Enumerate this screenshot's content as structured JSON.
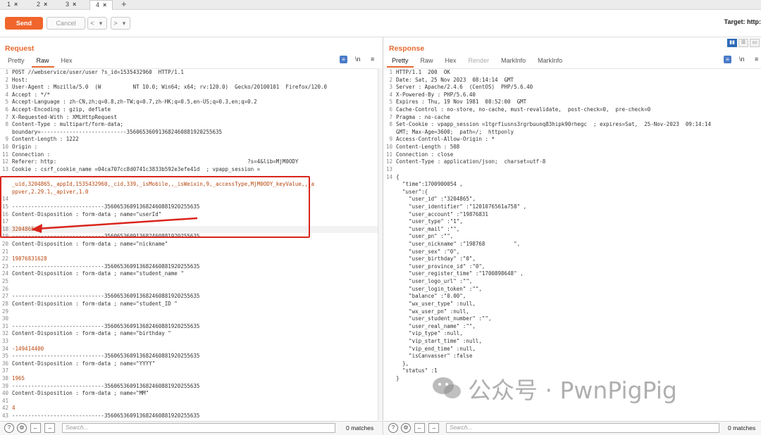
{
  "tabs": [
    {
      "label": "1",
      "close": "×"
    },
    {
      "label": "2",
      "close": "×"
    },
    {
      "label": "3",
      "close": "×"
    },
    {
      "label": "4",
      "close": "×",
      "active": true
    }
  ],
  "tab_add": "+",
  "toolbar": {
    "send_label": "Send",
    "cancel_label": "Cancel",
    "back": "<",
    "back_menu": "▾",
    "forward": ">",
    "forward_menu": "▾",
    "target_label": "Target: http:"
  },
  "request": {
    "title": "Request",
    "tabs": [
      "Pretty",
      "Raw",
      "Hex"
    ],
    "active_tab": "Raw",
    "wrap_label": "\\n",
    "menu_label": "≡",
    "lines": [
      "POST //webservice/user/user ?s_id=1535432960  HTTP/1.1",
      "Host:",
      "User-Agent : Mozilla/5.0  (W          NT 10.0; Win64; x64; rv:120.0)  Gecko/20100101  Firefox/120.0",
      "Accept : */*",
      "Accept-Language : zh-CN,zh;q=0.8,zh-TW;q=0.7,zh-HK;q=0.5,en-US;q=0.3,en;q=0.2",
      "Accept-Encoding : gzip, deflate",
      "X-Requested-With : XMLHttpRequest",
      "Content-Type : multipart/form-data;",
      "boundary=---------------------------356065360913682460881920255635",
      "Content-Length : 1222",
      "Origin :",
      "Connection :",
      "Referer: http:                                                            ?s=4&lib=MjM0ODY",
      "Cookie : csrf_cookie_name =04ca707cc8d0741c3833b592e3efe41d  ; vpapp_session =",
      "",
      "_uid,3204865,_appId,1535432960,_cid,339,_isMobile,,_isWeixin,9,_accessType,MjM0ODY_keyValue,,_a",
      "ppver,2.29.1,_apiver,1.0",
      "",
      "-----------------------------356065360913682460881920255635",
      "Content-Disposition : form-data ; name=\"userId\"",
      "",
      "3204865",
      "-----------------------------356065360913682460881920255635",
      "Content-Disposition : form-data ; name=\"nickname\"",
      "",
      "19876831628",
      "-----------------------------356065360913682460881920255635",
      "Content-Disposition : form-data ; name=\"student_name \"",
      "",
      "",
      "-----------------------------356065360913682460881920255635",
      "Content-Disposition : form-data ; name=\"student_ID \"",
      "",
      "",
      "-----------------------------356065360913682460881920255635",
      "Content-Disposition : form-data ; name=\"birthday \"",
      "",
      "-149414400",
      "-----------------------------356065360913682460881920255635",
      "Content-Disposition : form-data ; name=\"YYYY\"",
      "",
      "1965",
      "-----------------------------356065360913682460881920255635",
      "Content-Disposition : form-data ; name=\"MM\"",
      "",
      "4",
      "-----------------------------356065360913682460881920255635"
    ],
    "line_numbers": [
      "1",
      "2",
      "3",
      "4",
      "5",
      "6",
      "7",
      "8",
      "",
      "9",
      "10",
      "11",
      "12",
      "13",
      "",
      "",
      "",
      "14",
      "15",
      "16",
      "17",
      "18",
      "19",
      "20",
      "21",
      "22",
      "23",
      "24",
      "25",
      "26",
      "27",
      "28",
      "29",
      "30",
      "31",
      "32",
      "33",
      "34",
      "35",
      "36",
      "37",
      "38",
      "39",
      "40",
      "41",
      "42",
      "43"
    ],
    "search_placeholder": "Search...",
    "matches": "0 matches"
  },
  "response": {
    "title": "Response",
    "tabs": [
      "Pretty",
      "Raw",
      "Hex",
      "Render",
      "MarkInfo",
      "MarkInfo"
    ],
    "active_tab": "Pretty",
    "wrap_label": "\\n",
    "menu_label": "≡",
    "lines": [
      "HTTP/1.1  200  OK",
      "Date: Sat, 25 Nov 2023  08:14:14  GMT",
      "Server : Apache/2.4.6  (CentOS)  PHP/5.6.40",
      "X-Powered-By : PHP/5.6.40",
      "Expires : Thu, 19 Nov 1981  08:52:00  GMT",
      "Cache-Control : no-store, no-cache, must-revalidate,  post-check=0,  pre-check=0",
      "Pragma : no-cache",
      "Set-Cookie : vpapp_session =1tgrfiusns3rgrbuunq83hipk90rhegc  ; expires=Sat,  25-Nov-2023  09:14:14",
      "GMT; Max-Age=3600;  path=/;  httponly",
      "Access-Control-Allow-Origin : *",
      "Content-Length : 508",
      "Connection : close",
      "Content-Type : application/json;  charset=utf-8",
      "",
      "{",
      "  \"time\":1700900054 ,",
      "  \"user\":{",
      "    \"user_id\" :\"3204865\",",
      "    \"user_identifier\" :\"1201076561a758\" ,",
      "    \"user_account\" :\"19876831",
      "    \"user_type\" :\"1\",",
      "    \"user_mail\" :\"\",",
      "    \"user_pn\" :\"\",",
      "    \"user_nickname\" :\"198768         \",",
      "    \"user_sex\" :\"0\",",
      "    \"user_birthday\" :\"0\",",
      "    \"user_province_id\" :\"0\",",
      "    \"user_register_time\" :\"1700898648\" ,",
      "    \"user_logo_url\" :\"\",",
      "    \"user_login_token\" :\"\",",
      "    \"balance\" :\"0.00\",",
      "    \"wx_user_type\" :null,",
      "    \"wx_user_pn\" :null,",
      "    \"user_student_number\" :\"\",",
      "    \"user_real_name\" :\"\",",
      "    \"vip_type\" :null,",
      "    \"vip_start_time\" :null,",
      "    \"vip_end_time\" :null,",
      "    \"isCanvasser\" :false",
      "  },",
      "  \"status\" :1",
      "}"
    ],
    "line_numbers": [
      "1",
      "2",
      "3",
      "4",
      "5",
      "6",
      "7",
      "8",
      "",
      "9",
      "10",
      "11",
      "12",
      "13",
      "14",
      "",
      "",
      "",
      "",
      "",
      "",
      "",
      "",
      "",
      "",
      "",
      "",
      "",
      "",
      "",
      "",
      "",
      "",
      "",
      "",
      "",
      "",
      "",
      "",
      "",
      "",
      ""
    ],
    "search_placeholder": "Search...",
    "matches": "0 matches"
  },
  "watermark": "公众号 · PwnPigPig",
  "colors": {
    "send": "#f0652b",
    "accent": "#e8682f",
    "annotation": "#d9251c"
  }
}
